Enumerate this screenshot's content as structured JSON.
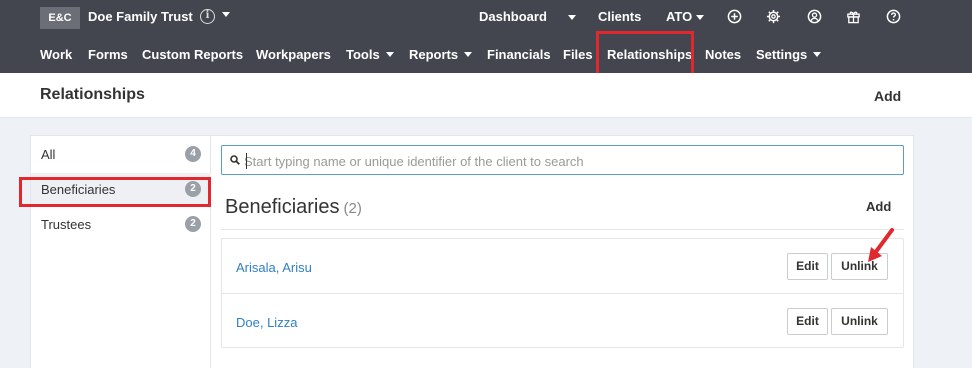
{
  "topbar": {
    "logo": "E&C",
    "client_name": "Doe Family Trust",
    "links": [
      "Dashboard",
      "Clients",
      "ATO"
    ],
    "icons": [
      "plus-circle-icon",
      "gear-icon",
      "user-circle-icon",
      "gift-icon",
      "help-icon"
    ]
  },
  "nav": {
    "items": [
      "Work",
      "Forms",
      "Custom Reports",
      "Workpapers",
      "Tools",
      "Reports",
      "Financials",
      "Files",
      "Relationships",
      "Notes",
      "Settings"
    ],
    "active": "Relationships",
    "highlight_color": "#e0282e"
  },
  "page": {
    "title": "Relationships",
    "add_label": "Add"
  },
  "sidebar": {
    "items": [
      {
        "label": "All",
        "count": "4"
      },
      {
        "label": "Beneficiaries",
        "count": "2"
      },
      {
        "label": "Trustees",
        "count": "2"
      }
    ],
    "selected": "Beneficiaries"
  },
  "search": {
    "placeholder": "Start typing name or unique identifier of the client to search"
  },
  "section": {
    "title": "Beneficiaries",
    "count": "(2)",
    "add_label": "Add"
  },
  "beneficiaries": [
    {
      "name": "Arisala, Arisu",
      "edit_label": "Edit",
      "unlink_label": "Unlink"
    },
    {
      "name": "Doe, Lizza",
      "edit_label": "Edit",
      "unlink_label": "Unlink"
    }
  ],
  "colors": {
    "topbar": "#43464f",
    "link": "#2f80c8",
    "annotation": "#e0282e"
  }
}
